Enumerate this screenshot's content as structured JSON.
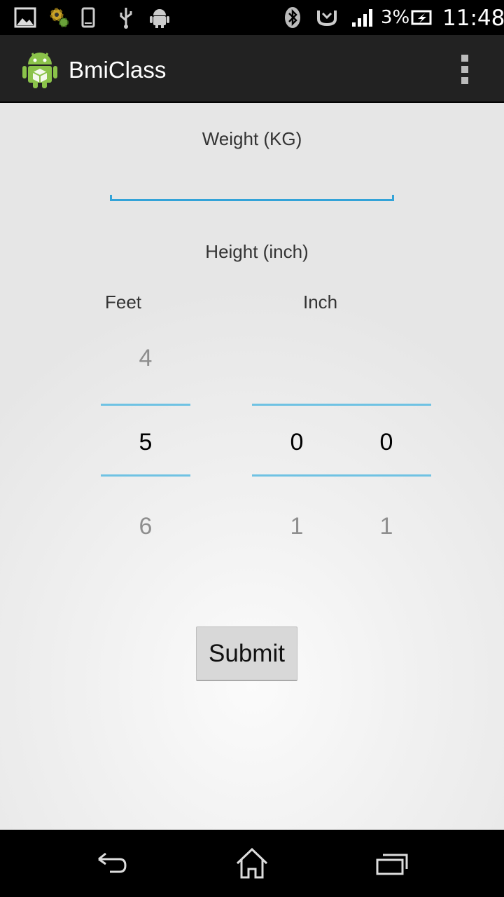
{
  "status_bar": {
    "battery_percent": "3%",
    "time": "11:48",
    "icons": [
      "gallery-icon",
      "gear-notification-icon",
      "phone-icon",
      "usb-icon",
      "android-debug-icon",
      "bluetooth-icon",
      "nfc-icon",
      "signal-icon",
      "battery-icon"
    ]
  },
  "action_bar": {
    "title": "BmiClass",
    "icons": [
      "app-android-icon",
      "overflow-menu-icon"
    ]
  },
  "form": {
    "weight_label": "Weight (KG)",
    "weight_value": "",
    "height_label": "Height (inch)",
    "feet_label": "Feet",
    "inch_label": "Inch",
    "feet_picker": {
      "above": "4",
      "selected": "5",
      "below": "6"
    },
    "inch_tens_picker": {
      "above": "",
      "selected": "0",
      "below": "1"
    },
    "inch_ones_picker": {
      "above": "",
      "selected": "0",
      "below": "1"
    },
    "submit_label": "Submit"
  },
  "nav_bar": {
    "icons": [
      "back-icon",
      "home-icon",
      "recent-apps-icon"
    ]
  },
  "colors": {
    "accent": "#33a3d8",
    "picker_divider": "#6fc2e3",
    "action_bar": "#222222"
  }
}
